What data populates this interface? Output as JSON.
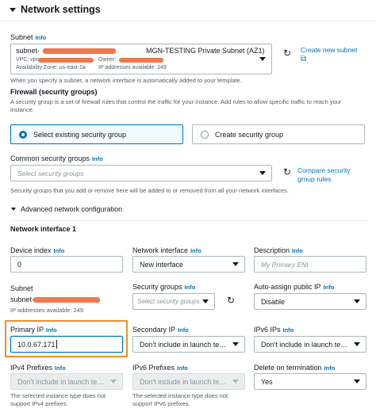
{
  "section": {
    "title": "Network settings"
  },
  "subnet": {
    "label": "Subnet",
    "info": "Info",
    "value_prefix": "subnet-",
    "value_name": "MGN-TESTING Private Subnet (AZ1)",
    "vpc_prefix": "VPC: vpc-",
    "owner_label": "Owner:",
    "az": "Availability Zone: us-east-1a",
    "ips": "IP addresses available: 249",
    "help": "When you specify a subnet, a network interface is automatically added to your template.",
    "create_link": "Create new subnet"
  },
  "firewall": {
    "label": "Firewall (security groups)",
    "desc": "A security group is a set of firewall rules that control the traffic for your instance. Add rules to allow specific traffic to reach your instance.",
    "option_existing": "Select existing security group",
    "option_create": "Create security group",
    "selected": "existing"
  },
  "common_sg": {
    "label": "Common security groups",
    "info": "Info",
    "placeholder": "Select security groups",
    "compare_link": "Compare security group rules",
    "help": "Security groups that you add or remove here will be added to or removed from all your network interfaces."
  },
  "advanced": {
    "title": "Advanced network configuration",
    "interface_title": "Network interface 1"
  },
  "fields": {
    "device_index": {
      "label": "Device index",
      "info": "Info",
      "value": "0"
    },
    "network_interface": {
      "label": "Network interface",
      "info": "Info",
      "value": "New interface"
    },
    "description": {
      "label": "Description",
      "info": "Info",
      "placeholder": "My Primary ENI"
    },
    "subnet": {
      "label": "Subnet",
      "value_prefix": "subnet-",
      "ips": "IP addresses available: 249"
    },
    "security_groups": {
      "label": "Security groups",
      "info": "Info",
      "placeholder": "Select security groups"
    },
    "auto_assign": {
      "label": "Auto-assign public IP",
      "info": "Info",
      "value": "Disable"
    },
    "primary_ip": {
      "label": "Primary IP",
      "info": "Info",
      "value": "10.0.67.171"
    },
    "secondary_ip": {
      "label": "Secondary IP",
      "info": "Info",
      "value": "Don't include in launch template"
    },
    "ipv6_ips": {
      "label": "IPv6 IPs",
      "info": "Info",
      "value": "Don't include in launch template"
    },
    "ipv4_prefixes": {
      "label": "IPv4 Prefixes",
      "info": "Info",
      "value": "Don't include in launch template",
      "help": "The selected instance type does not support IPv4 prefixes."
    },
    "ipv6_prefixes": {
      "label": "IPv6 Prefixes",
      "info": "Info",
      "value": "Don't include in launch template",
      "help": "The selected instance type does not support IPv6 prefixes."
    },
    "delete_on_termination": {
      "label": "Delete on termination",
      "info": "Info",
      "value": "Yes"
    }
  },
  "colors": {
    "link": "#0073bb",
    "highlight": "#e8912d",
    "selected_bg": "#f1faff",
    "redaction": "#f0693a"
  }
}
